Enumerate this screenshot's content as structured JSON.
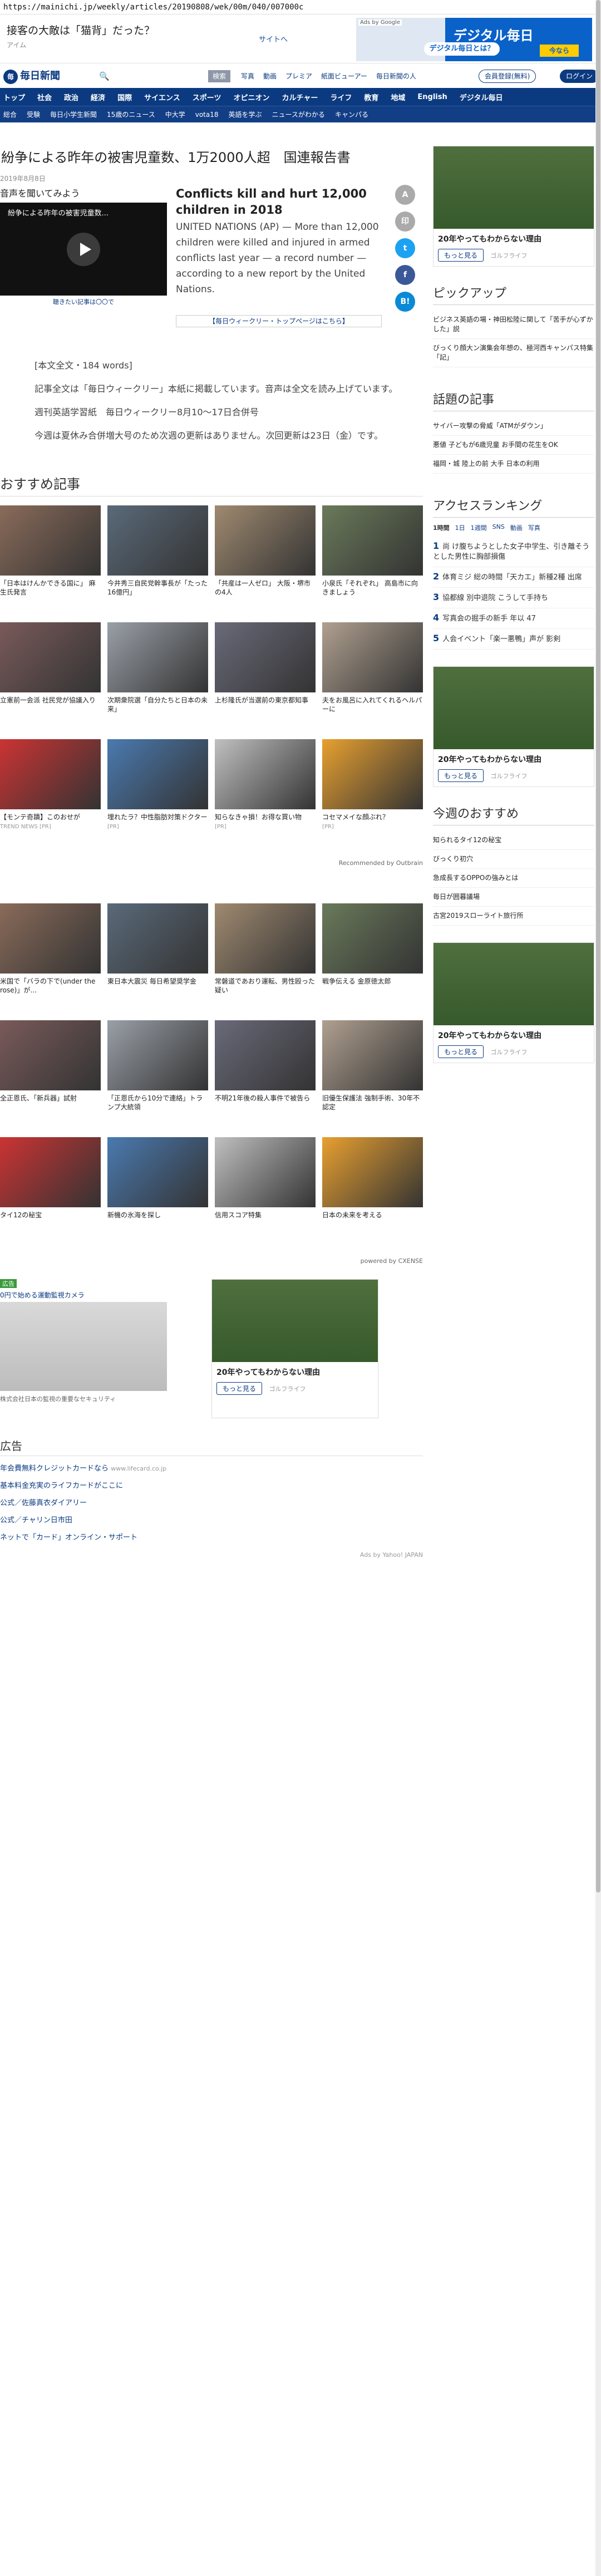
{
  "url": "https://mainichi.jp/weekly/articles/20190808/wek/00m/040/007000c",
  "topad": {
    "quiz": "接客の大敵は「猫背」だった？",
    "sub": "アイム",
    "site": "サイトへ",
    "banner_tag": "Ads by Google",
    "banner_logo": "デジタル毎日",
    "banner_btn": "デジタル毎日とは？",
    "banner_flag": "今なら"
  },
  "header": {
    "logo": "毎日新聞",
    "logo_mark": "毎",
    "photos": "写真",
    "video": "動画",
    "premier": "プレミア",
    "book": "紙面ビューアー",
    "people": "毎日新聞の人",
    "tab": "検索",
    "reg": "会員登録(無料)",
    "login": "ログイン"
  },
  "nav1": [
    "トップ",
    "社会",
    "政治",
    "経済",
    "国際",
    "サイエンス",
    "スポーツ",
    "オピニオン",
    "カルチャー",
    "ライフ",
    "教育",
    "地域",
    "English",
    "デジタル毎日"
  ],
  "nav2": [
    "総合",
    "受験",
    "毎日小学生新聞",
    "15歳のニュース",
    "中大学",
    "vota18",
    "英語を学ぶ",
    "ニュースがわかる",
    "キャンパる"
  ],
  "article": {
    "title": "紛争による昨年の被害児童数、1万2000人超　国連報告書",
    "date": "2019年8月8日",
    "listen": "音声を聞いてみよう",
    "video_title": "紛争による昨年の被害児童数...",
    "video_cap": "聴きたい記事は〇〇で",
    "en_title": "Conflicts kill and hurt 12,000 children in 2018",
    "en_body": "UNITED NATIONS (AP) — More than 12,000 children were killed and injured in armed conflicts last year — a record number — according to a new report by the United Nations.",
    "wk": "【毎日ウィークリー・トップページはこちら】",
    "p1": "[本文全文・184 words]",
    "p2": "記事全文は「毎日ウィークリー」本紙に掲載しています。音声は全文を読み上げています。",
    "p3": "週刊英語学習紙　毎日ウィークリー8月10～17日合併号",
    "p4": "今週は夏休み合併増大号のため次週の更新はありません。次回更新は23日（金）です。"
  },
  "share": {
    "a": "A",
    "print": "印",
    "tw": "t",
    "fb": "f",
    "b": "B!"
  },
  "reco": {
    "title": "おすすめ記事",
    "cards": [
      {
        "cap": "「日本はけんかできる国に」 麻生氏発言",
        "src": ""
      },
      {
        "cap": "今井秀三自民党幹事長が「たった16億円」",
        "src": ""
      },
      {
        "cap": "「共産は一人ゼロ」 大阪・堺市の4人",
        "src": ""
      },
      {
        "cap": "小泉氏「それぞれ」 高島市に向きましょう",
        "src": ""
      },
      {
        "cap": "立憲前一会派 社民党が協議入り",
        "src": ""
      },
      {
        "cap": "次期衆院選「自分たちと日本の未来」",
        "src": ""
      },
      {
        "cap": "上杉隆氏が当選前の東京都知事",
        "src": ""
      },
      {
        "cap": "夫をお風呂に入れてくれるヘルパーに",
        "src": ""
      },
      {
        "cap": "【モンテ奇蹟】このおせが",
        "src": "TREND NEWS [PR]"
      },
      {
        "cap": "埋れたラ？中性脂肪対策ドクター",
        "src": "[PR]"
      },
      {
        "cap": "知らなきゃ損！お得な買い物",
        "src": "[PR]"
      },
      {
        "cap": "コセマメイな顔ぶれ？",
        "src": "[PR]"
      }
    ],
    "powered": "Recommended by Outbrain"
  },
  "grid2": {
    "cards": [
      {
        "cap": "米国で「バラの下で(under the rose)」が…"
      },
      {
        "cap": "東日本大震災 毎日希望奨学金"
      },
      {
        "cap": "常磐道であおり運転、男性殴った疑い"
      },
      {
        "cap": "戦争伝える 金原徳太郎"
      },
      {
        "cap": "全正恩氏、「新兵器」試射"
      },
      {
        "cap": "「正恩氏から10分で連絡」トランプ大統領"
      },
      {
        "cap": "不明21年後の殺人事件で被告ら"
      },
      {
        "cap": "旧優生保護法 強制手術、30年不認定"
      },
      {
        "cap": "タイ12の秘宝"
      },
      {
        "cap": "新機の氷海を探し"
      },
      {
        "cap": "信用スコア特集"
      },
      {
        "cap": "日本の未来を考える"
      }
    ],
    "powered": "powered by CXENSE"
  },
  "bottom_ads": {
    "a1_tag": "広告",
    "a1_title": "0円で始める運動監視カメラ",
    "a1_cap": "株式会社日本の監視の重要なセキュリティ",
    "a2_cap": "20年やってもわからない理由",
    "a2_btn": "もっと見る",
    "a2_src": "ゴルフライフ"
  },
  "footer": {
    "title": "広告",
    "rows": [
      {
        "t": "年会費無料クレジットカードなら",
        "s": "www.lifecard.co.jp"
      },
      {
        "t": "基本料金充実のライフカードがここに",
        "s": ""
      },
      {
        "t": "公式／佐藤真衣ダイアリー",
        "s": ""
      },
      {
        "t": "公式／チャリン日市田",
        "s": ""
      },
      {
        "t": "ネットで「カード」オンライン・サポート",
        "s": ""
      }
    ],
    "adsby": "Ads by Yahoo! JAPAN"
  },
  "side": {
    "ad_cap": "20年やってもわからない理由",
    "ad_btn": "もっと見る",
    "ad_src": "ゴルフライフ",
    "pickup_title": "ピックアップ",
    "pickup": [
      "ビジネス英語の場・神田松陸に関して「苦手が心ずかした」説",
      "びっくり顔大ン演集会年想の、極河西キャンパス特集「記」"
    ],
    "topic_title": "話題の記事",
    "topics": [
      "サイバー攻撃の脅威「ATMがダウン」",
      "悪値 子どもが6歳児童 お手間の花生をOK",
      "福岡・城 陸上の前 大手 日本の利用"
    ],
    "rank_title": "アクセスランキング",
    "rank_tabs": [
      "1時間",
      "1日",
      "1週間",
      "SNS",
      "動画",
      "写真"
    ],
    "ranks": [
      "尚 け腹ちようとした女子中学生、引き離そうとした男性に胸部損傷",
      "体育ミジ 総の時間「天カエ」新種2種 出席",
      "協都線 別中退院 こうして手持ち",
      "写真会の掘手の新手 年以 47",
      "人会イベント「楽一悪鴨」声が 影剣"
    ],
    "osusume_title": "今週のおすすめ",
    "osusume": [
      "知られるタイ12の秘宝",
      "びっくり初穴",
      "急成長するOPPOの強みとは",
      "毎日が囲暮議場",
      "古宮2019スローライト旅行所"
    ]
  }
}
